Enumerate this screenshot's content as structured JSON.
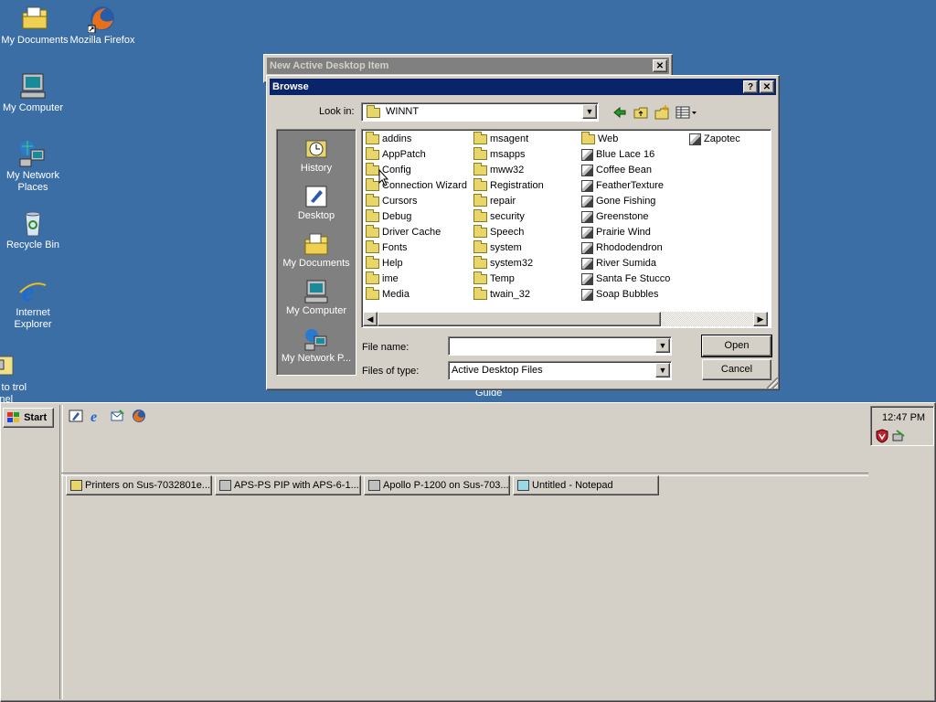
{
  "desktop": {
    "icons": [
      {
        "label": "My Documents",
        "icon": "folder-documents-icon"
      },
      {
        "label": "Mozilla Firefox",
        "icon": "firefox-icon"
      },
      {
        "label": "My Computer",
        "icon": "computer-icon"
      },
      {
        "label": "My Network Places",
        "icon": "network-icon"
      },
      {
        "label": "Recycle Bin",
        "icon": "recycle-bin-icon"
      },
      {
        "label": "Internet Explorer",
        "icon": "ie-icon"
      },
      {
        "label": "ortcut to trol Panel",
        "icon": "control-panel-shortcut-icon"
      }
    ],
    "partial_label": "Guide"
  },
  "back_window": {
    "title": "New Active Desktop Item",
    "close": "✕"
  },
  "browse_dialog": {
    "title": "Browse",
    "help": "?",
    "close": "✕",
    "look_in_label": "Look in:",
    "look_in_value": "WINNT",
    "places": [
      {
        "label": "History"
      },
      {
        "label": "Desktop"
      },
      {
        "label": "My Documents"
      },
      {
        "label": "My Computer"
      },
      {
        "label": "My Network P..."
      }
    ],
    "files": [
      {
        "name": "addins",
        "type": "folder"
      },
      {
        "name": "AppPatch",
        "type": "folder"
      },
      {
        "name": "Config",
        "type": "folder"
      },
      {
        "name": "Connection Wizard",
        "type": "folder"
      },
      {
        "name": "Cursors",
        "type": "folder"
      },
      {
        "name": "Debug",
        "type": "folder"
      },
      {
        "name": "Driver Cache",
        "type": "folder"
      },
      {
        "name": "Fonts",
        "type": "folder"
      },
      {
        "name": "Help",
        "type": "folder"
      },
      {
        "name": "ime",
        "type": "folder"
      },
      {
        "name": "Media",
        "type": "folder"
      },
      {
        "name": "msagent",
        "type": "folder"
      },
      {
        "name": "msapps",
        "type": "folder"
      },
      {
        "name": "mww32",
        "type": "folder"
      },
      {
        "name": "Registration",
        "type": "folder"
      },
      {
        "name": "repair",
        "type": "folder"
      },
      {
        "name": "security",
        "type": "folder"
      },
      {
        "name": "Speech",
        "type": "folder"
      },
      {
        "name": "system",
        "type": "folder"
      },
      {
        "name": "system32",
        "type": "folder"
      },
      {
        "name": "Temp",
        "type": "folder"
      },
      {
        "name": "twain_32",
        "type": "folder"
      },
      {
        "name": "Web",
        "type": "folder"
      },
      {
        "name": "Blue Lace 16",
        "type": "bitmap"
      },
      {
        "name": "Coffee Bean",
        "type": "bitmap"
      },
      {
        "name": "FeatherTexture",
        "type": "bitmap"
      },
      {
        "name": "Gone Fishing",
        "type": "bitmap"
      },
      {
        "name": "Greenstone",
        "type": "bitmap"
      },
      {
        "name": "Prairie Wind",
        "type": "bitmap"
      },
      {
        "name": "Rhododendron",
        "type": "bitmap"
      },
      {
        "name": "River Sumida",
        "type": "bitmap"
      },
      {
        "name": "Santa Fe Stucco",
        "type": "bitmap"
      },
      {
        "name": "Soap Bubbles",
        "type": "bitmap"
      },
      {
        "name": "Zapotec",
        "type": "bitmap"
      }
    ],
    "file_name_label": "File name:",
    "file_name_value": "",
    "files_of_type_label": "Files of type:",
    "files_of_type_value": "Active Desktop Files",
    "open_label": "Open",
    "cancel_label": "Cancel"
  },
  "taskbar": {
    "start_label": "Start",
    "clock": "12:47 PM",
    "tasks": [
      {
        "label": "Printers on Sus-7032801e..."
      },
      {
        "label": "APS-PS PIP with APS-6-1..."
      },
      {
        "label": "Apollo P-1200 on Sus-703..."
      },
      {
        "label": "Untitled - Notepad"
      }
    ]
  },
  "colors": {
    "desktop": "#3a6ea5",
    "title_active": "#0a246a",
    "title_inactive": "#808080",
    "face": "#d4d0c8"
  }
}
